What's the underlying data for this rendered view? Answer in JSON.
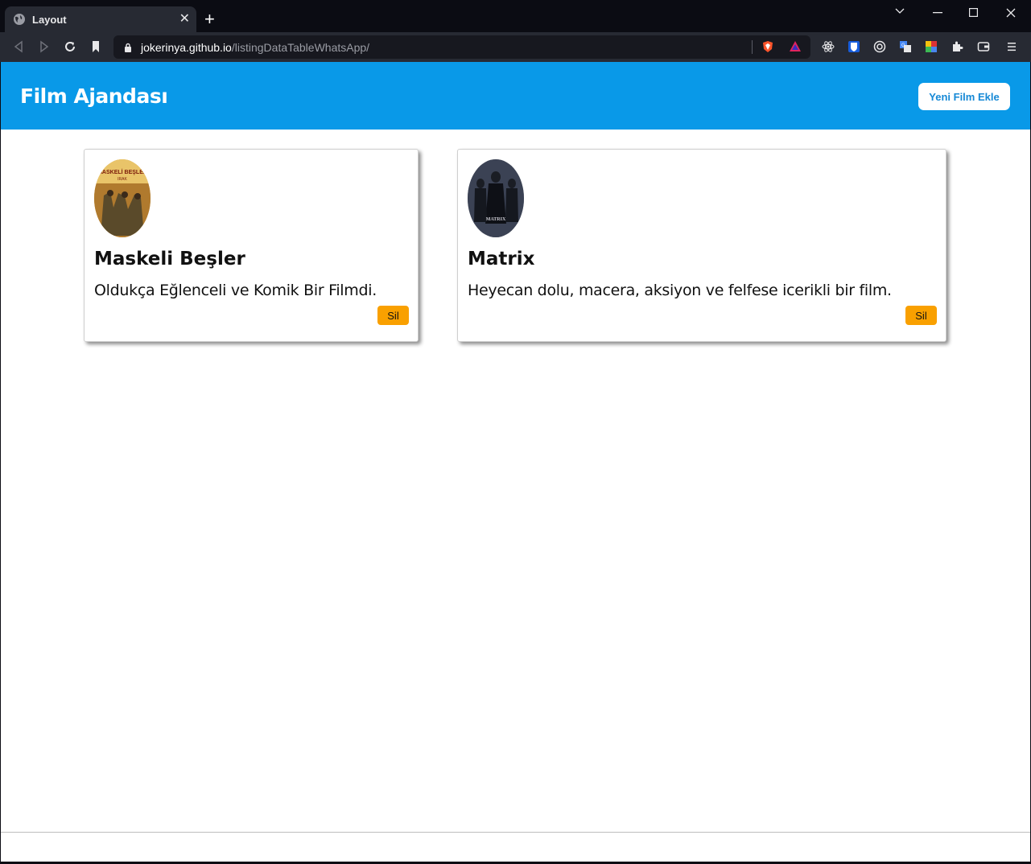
{
  "browser": {
    "tab_title": "Layout",
    "url_host": "jokerinya.github.io",
    "url_path": "/listingDataTableWhatsApp/"
  },
  "header": {
    "brand": "Film Ajandası",
    "add_button": "Yeni Film Ekle"
  },
  "films": [
    {
      "title": "Maskeli Beşler",
      "description": "Oldukça Eğlenceli ve Komik Bir Filmdi.",
      "poster_caption": "MASKELİ BEŞLER IRAK",
      "delete_label": "Sil"
    },
    {
      "title": "Matrix",
      "description": "Heyecan dolu, macera, aksiyon ve felfese icerikli bir film.",
      "poster_caption": "MATRIX",
      "delete_label": "Sil"
    }
  ],
  "colors": {
    "header_bg": "#0999e8",
    "delete_button": "#f9a000",
    "add_button_text": "#1689d6"
  }
}
